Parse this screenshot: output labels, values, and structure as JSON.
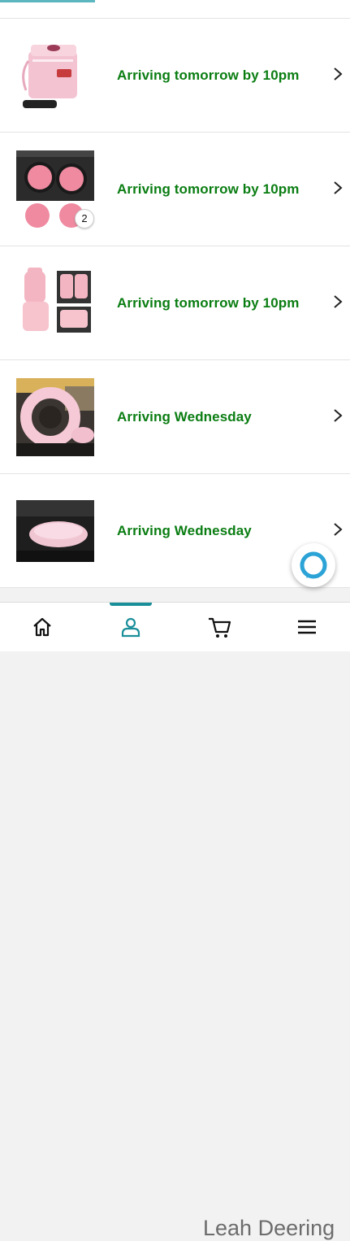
{
  "orders": [
    {
      "status": "Arriving tomorrow by 10pm",
      "image": "pink-car-trash-can",
      "quantity_badge": ""
    },
    {
      "status": "Arriving tomorrow by 10pm",
      "image": "pink-cup-holder-coasters",
      "quantity_badge": "2"
    },
    {
      "status": "Arriving tomorrow by 10pm",
      "image": "pink-seat-covers",
      "quantity_badge": ""
    },
    {
      "status": "Arriving Wednesday",
      "image": "pink-fluffy-steering-wheel-cover",
      "quantity_badge": ""
    },
    {
      "status": "Arriving Wednesday",
      "image": "pink-fluffy-armrest-cover",
      "quantity_badge": ""
    }
  ],
  "alexa": {
    "icon": "alexa-icon"
  },
  "bottom_nav": {
    "items": [
      {
        "icon": "home-icon",
        "active": false
      },
      {
        "icon": "user-icon",
        "active": true
      },
      {
        "icon": "cart-icon",
        "active": false
      },
      {
        "icon": "menu-icon",
        "active": false
      }
    ]
  },
  "watermark": "Leah Deering",
  "colors": {
    "status_green": "#0a7d12",
    "accent_teal": "#1a8f9a",
    "alexa_blue": "#2ba3d6",
    "divider": "#e3e3e3"
  }
}
